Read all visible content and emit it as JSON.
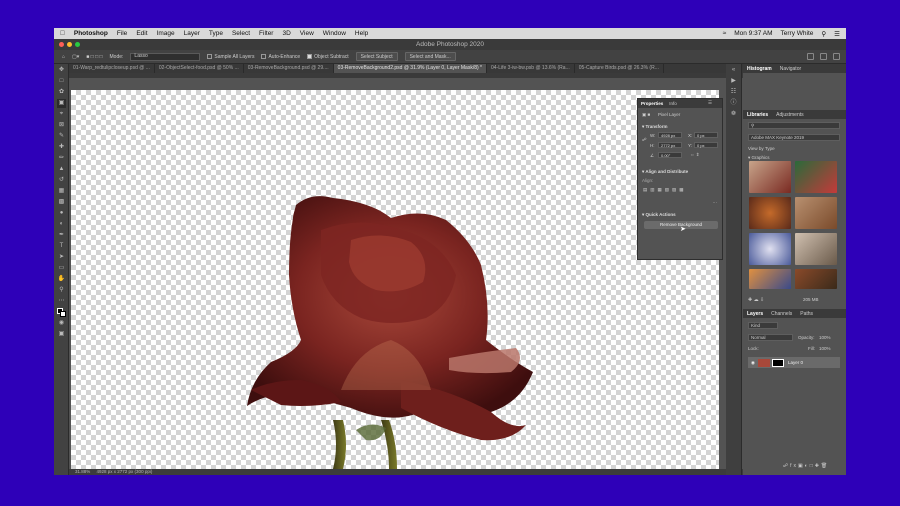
{
  "menubar": {
    "app_name": "Photoshop",
    "items": [
      "File",
      "Edit",
      "Image",
      "Layer",
      "Type",
      "Select",
      "Filter",
      "3D",
      "View",
      "Window",
      "Help"
    ],
    "datetime": "Mon 9:37 AM",
    "user": "Terry White"
  },
  "window": {
    "title": "Adobe Photoshop 2020"
  },
  "options_bar": {
    "mode_label": "Mode:",
    "mode_value": "Lasso",
    "sample_all_layers": "Sample All Layers",
    "auto_enhance": "Auto-Enhance",
    "object_subtract": "Object Subtract",
    "select_subject": "Select Subject",
    "select_and_mask": "Select and Mask..."
  },
  "tabs": [
    {
      "label": "01-Warp_redtulipcloseup.psd @ ..."
    },
    {
      "label": "02-ObjectSelect-food.psd @ 50% ..."
    },
    {
      "label": "03-RemoveBackground.psd @ 29...."
    },
    {
      "label": "03-RemoveBackground2.psd @ 31.9% (Layer 0, Layer Mask/8) *",
      "active": true
    },
    {
      "label": "04-Life 3-iw-bw.psb @ 13.6% (Ra..."
    },
    {
      "label": "05-Capture Birds.psd @ 26.3% (R..."
    }
  ],
  "status": {
    "zoom": "31.88%",
    "doc_size": "4928 px x 2772 px (300 ppi)"
  },
  "properties": {
    "tab_active": "Properties",
    "tab_other": "Info",
    "layer_type": "Pixel Layer",
    "transform_label": "Transform",
    "w_label": "W:",
    "w_value": "4928 px",
    "h_label": "H:",
    "h_value": "2772 px",
    "x_label": "X:",
    "x_value": "0 px",
    "y_label": "Y:",
    "y_value": "0 px",
    "angle_value": "0.00°",
    "align_label": "Align and Distribute",
    "align_sub": "Align:",
    "quick_actions_label": "Quick Actions",
    "remove_bg_button": "Remove Background"
  },
  "right_panel": {
    "top_tabs": [
      "Histogram",
      "Navigator"
    ],
    "lib_tabs": [
      "Libraries",
      "Adjustments"
    ],
    "library_name": "Adobe MAX Keynote 2019",
    "view_by": "View by Type",
    "graphics_label": "Graphics",
    "storage": "205 MB",
    "layer_tabs": [
      "Layers",
      "Channels",
      "Paths"
    ],
    "kind_label": "Kind",
    "blend_mode": "Normal",
    "opacity_label": "Opacity:",
    "opacity_value": "100%",
    "lock_label": "Lock:",
    "fill_label": "Fill:",
    "fill_value": "100%",
    "layer_name": "Layer 0"
  },
  "colors": {
    "background": "#2e00b8",
    "panel": "#535353",
    "rose_dark": "#5a1414",
    "rose_mid": "#8b2a22"
  }
}
